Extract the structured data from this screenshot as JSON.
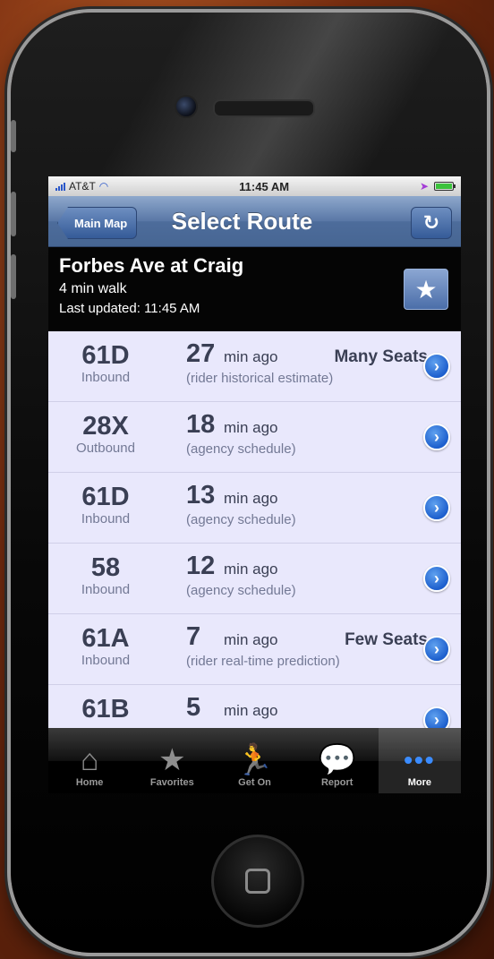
{
  "status_bar": {
    "carrier": "AT&T",
    "time": "11:45 AM"
  },
  "nav": {
    "back_label": "Main Map",
    "title": "Select Route",
    "refresh_icon": "refresh-icon"
  },
  "stop": {
    "name": "Forbes Ave at Craig",
    "walk": "4 min walk",
    "updated": "Last updated: 11:45 AM",
    "fav_icon": "star-icon"
  },
  "routes": [
    {
      "route": "61D",
      "direction": "Inbound",
      "minutes": "27",
      "min_label": "min ago",
      "seats": "Many Seats",
      "source": "(rider historical estimate)"
    },
    {
      "route": "28X",
      "direction": "Outbound",
      "minutes": "18",
      "min_label": "min ago",
      "seats": "",
      "source": "(agency schedule)"
    },
    {
      "route": "61D",
      "direction": "Inbound",
      "minutes": "13",
      "min_label": "min ago",
      "seats": "",
      "source": "(agency schedule)"
    },
    {
      "route": "58",
      "direction": "Inbound",
      "minutes": "12",
      "min_label": "min ago",
      "seats": "",
      "source": "(agency schedule)"
    },
    {
      "route": "61A",
      "direction": "Inbound",
      "minutes": "7",
      "min_label": "min ago",
      "seats": "Few Seats",
      "source": "(rider real-time prediction)"
    },
    {
      "route": "61B",
      "direction": "",
      "minutes": "5",
      "min_label": "min ago",
      "seats": "",
      "source": ""
    }
  ],
  "tabs": [
    {
      "label": "Home",
      "icon": "home-icon",
      "glyph": "⌂"
    },
    {
      "label": "Favorites",
      "icon": "star-icon",
      "glyph": "★"
    },
    {
      "label": "Get On",
      "icon": "running-person-icon",
      "glyph": "🏃"
    },
    {
      "label": "Report",
      "icon": "speech-bubble-icon",
      "glyph": "💬"
    },
    {
      "label": "More",
      "icon": "more-dots-icon",
      "glyph": "•••"
    }
  ],
  "colors": {
    "nav_blue": "#4d6c9b",
    "row_bg": "#e9e8fc",
    "chevron_blue": "#1d5fcd",
    "tab_active": "#3b8cff"
  }
}
